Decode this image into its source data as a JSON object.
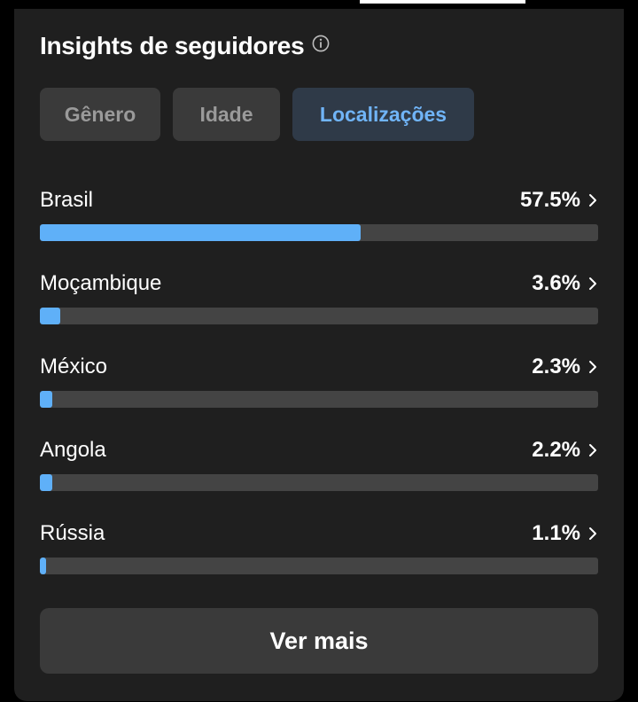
{
  "header": {
    "title": "Insights de seguidores",
    "info_icon": "info-circle-icon"
  },
  "tabs": [
    {
      "label": "Gênero",
      "active": false
    },
    {
      "label": "Idade",
      "active": false
    },
    {
      "label": "Localizações",
      "active": true
    }
  ],
  "locations": [
    {
      "name": "Brasil",
      "value": "57.5%",
      "percent": 57.5
    },
    {
      "name": "Moçambique",
      "value": "3.6%",
      "percent": 3.6
    },
    {
      "name": "México",
      "value": "2.3%",
      "percent": 2.3
    },
    {
      "name": "Angola",
      "value": "2.2%",
      "percent": 2.2
    },
    {
      "name": "Rússia",
      "value": "1.1%",
      "percent": 1.1
    }
  ],
  "see_more_label": "Ver mais",
  "colors": {
    "background": "#1f1f1f",
    "bar_fill": "#5fb0f8",
    "bar_track": "#444444",
    "tab_active_bg": "#2f3a48",
    "tab_active_text": "#70b4f7"
  }
}
